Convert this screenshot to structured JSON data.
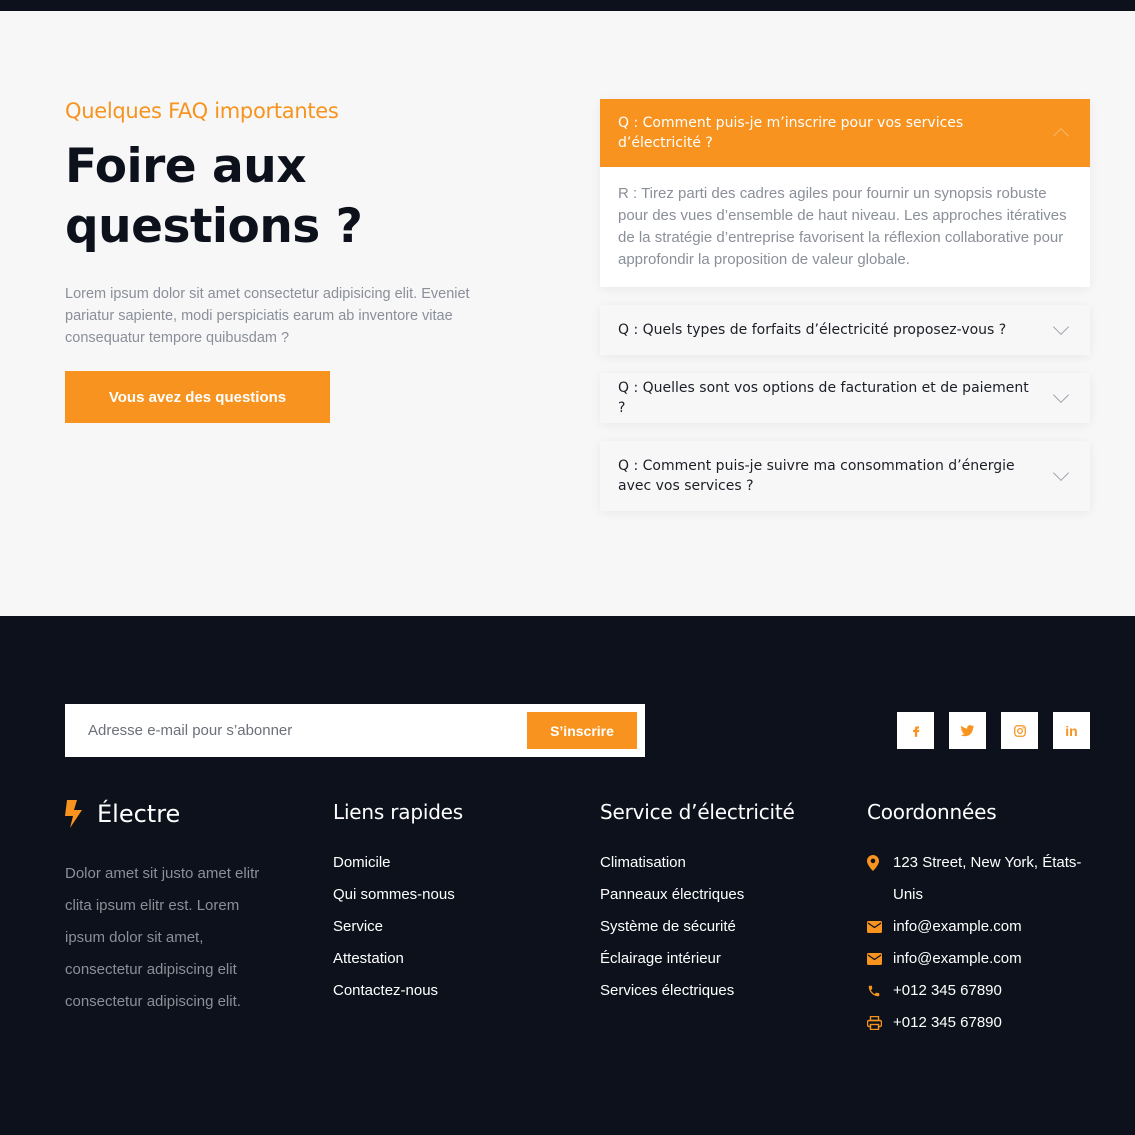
{
  "faq": {
    "eyebrow": "Quelques FAQ importantes",
    "title": "Foire aux questions ?",
    "description": "Lorem ipsum dolor sit amet consectetur adipisicing elit. Eveniet pariatur sapiente, modi perspiciatis earum ab inventore vitae consequatur tempore quibusdam ?",
    "button_label": "Vous avez des questions",
    "items": [
      {
        "question": "Q : Comment puis-je m’inscrire pour vos services d’électricité ?",
        "answer": "R : Tirez parti des cadres agiles pour fournir un synopsis robuste pour des vues d’ensemble de haut niveau. Les approches itératives de la stratégie d’entreprise favorisent la réflexion collaborative pour approfondir la proposition de valeur globale.",
        "open": true
      },
      {
        "question": "Q : Quels types de forfaits d’électricité proposez-vous ?",
        "open": false
      },
      {
        "question": "Q : Quelles sont vos options de facturation et de paiement ?",
        "open": false
      },
      {
        "question": "Q : Comment puis-je suivre ma consommation d’énergie avec vos services ?",
        "open": false
      }
    ]
  },
  "footer": {
    "newsletter": {
      "placeholder": "Adresse e-mail pour s’abonner",
      "button_label": "S’inscrire"
    },
    "socials": [
      {
        "name": "facebook-icon",
        "glyph": "f"
      },
      {
        "name": "twitter-icon",
        "glyph": "🐦"
      },
      {
        "name": "instagram-icon",
        "glyph": "◎"
      },
      {
        "name": "linkedin-icon",
        "glyph": "in"
      }
    ],
    "brand": {
      "name": "Électre",
      "description": "Dolor amet sit justo amet elitr clita ipsum elitr est. Lorem ipsum dolor sit amet, consectetur adipiscing elit consectetur adipiscing elit."
    },
    "quick_links": {
      "heading": "Liens rapides",
      "items": [
        "Domicile",
        "Qui sommes-nous",
        "Service",
        "Attestation",
        "Contactez-nous"
      ]
    },
    "services": {
      "heading": "Service d’électricité",
      "items": [
        "Climatisation",
        "Panneaux électriques",
        "Système de sécurité",
        "Éclairage intérieur",
        "Services électriques"
      ]
    },
    "contact": {
      "heading": "Coordonnées",
      "address": "123 Street, New York, États-Unis",
      "email_1": "info@example.com",
      "email_2": "info@example.com",
      "phone": "+012 345 67890",
      "fax": "+012 345 67890"
    }
  },
  "colors": {
    "accent": "#f7931e",
    "dark": "#0c111b",
    "muted": "#8a8f98"
  }
}
